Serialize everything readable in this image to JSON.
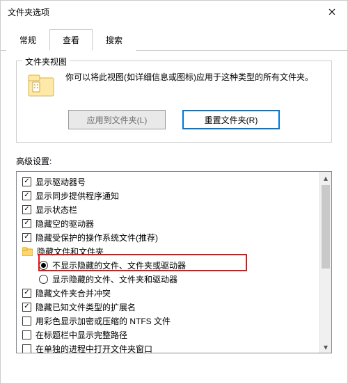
{
  "window": {
    "title": "文件夹选项"
  },
  "tabs": {
    "t0": "常规",
    "t1": "查看",
    "t2": "搜索",
    "active": 1
  },
  "group": {
    "title": "文件夹视图",
    "text": "你可以将此视图(如详细信息或图标)应用于这种类型的所有文件夹。",
    "apply_btn": "应用到文件夹(L)",
    "reset_btn": "重置文件夹(R)"
  },
  "adv": {
    "label": "高级设置:",
    "items": {
      "i0": "显示驱动器号",
      "i1": "显示同步提供程序通知",
      "i2": "显示状态栏",
      "i3": "隐藏空的驱动器",
      "i4": "隐藏受保护的操作系统文件(推荐)",
      "g0": "隐藏文件和文件夹",
      "r0": "不显示隐藏的文件、文件夹或驱动器",
      "r1": "显示隐藏的文件、文件夹和驱动器",
      "i5": "隐藏文件夹合并冲突",
      "i6": "隐藏已知文件类型的扩展名",
      "i7": "用彩色显示加密或压缩的 NTFS 文件",
      "i8": "在标题栏中显示完整路径",
      "i9": "在单独的进程中打开文件夹窗口"
    }
  }
}
